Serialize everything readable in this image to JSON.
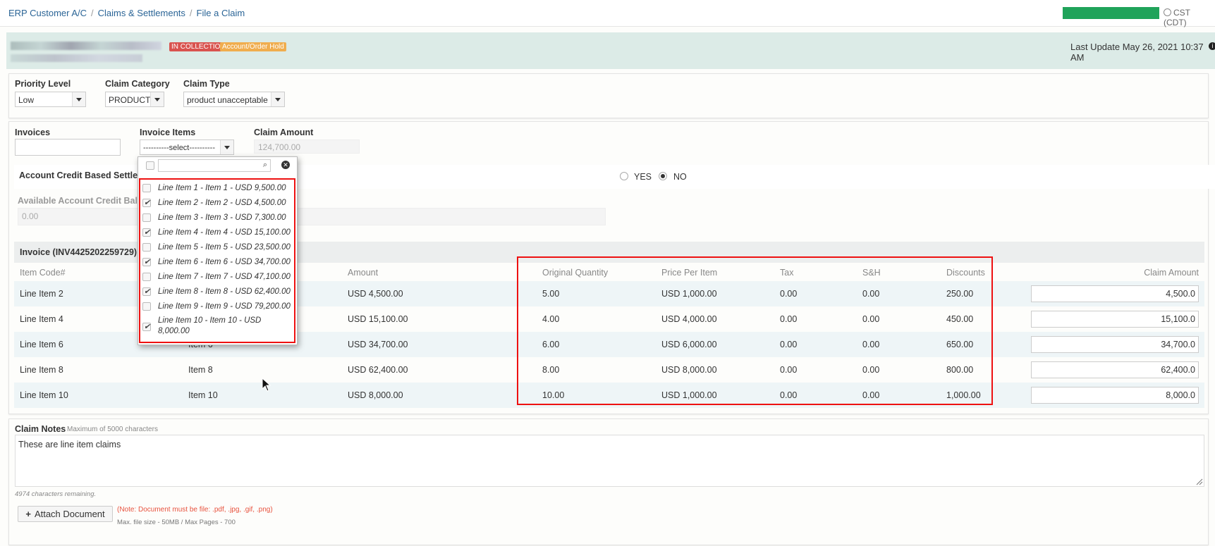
{
  "breadcrumb": [
    "ERP Customer A/C",
    "Claims & Settlements",
    "File a Claim"
  ],
  "timezone": "CST (CDT)",
  "header": {
    "badge_collection": "IN COLLECTION",
    "badge_hold": "Account/Order Hold",
    "last_update": "Last Update May 26, 2021 10:37 AM"
  },
  "claim_setup": {
    "priority_label": "Priority Level",
    "priority_value": "Low",
    "category_label": "Claim Category",
    "category_value": "PRODUCT",
    "type_label": "Claim Type",
    "type_value": "product unacceptable"
  },
  "invoice_section": {
    "invoices_label": "Invoices",
    "items_label": "Invoice Items",
    "items_value": "----------select----------",
    "claim_amount_label": "Claim Amount",
    "claim_amount_value": "124,700.00"
  },
  "credit": {
    "settlement_label": "Account Credit Based Settleme",
    "yes": "YES",
    "no": "NO",
    "selected": "NO",
    "available_label": "Available Account Credit Balan",
    "available_value": "0.00"
  },
  "dropdown": {
    "items": [
      {
        "label": "Line Item 1 - Item 1 - USD 9,500.00",
        "checked": false
      },
      {
        "label": "Line Item 2 - Item 2 - USD 4,500.00",
        "checked": true
      },
      {
        "label": "Line Item 3 - Item 3 - USD 7,300.00",
        "checked": false
      },
      {
        "label": "Line Item 4 - Item 4 - USD 15,100.00",
        "checked": true
      },
      {
        "label": "Line Item 5 - Item 5 - USD 23,500.00",
        "checked": false
      },
      {
        "label": "Line Item 6 - Item 6 - USD 34,700.00",
        "checked": true
      },
      {
        "label": "Line Item 7 - Item 7 - USD 47,100.00",
        "checked": false
      },
      {
        "label": "Line Item 8 - Item 8 - USD 62,400.00",
        "checked": true
      },
      {
        "label": "Line Item 9 - Item 9 - USD 79,200.00",
        "checked": false
      },
      {
        "label": "Line Item 10 - Item 10 - USD 8,000.00",
        "checked": true
      }
    ]
  },
  "table": {
    "title": "Invoice (INV4425202259729) It",
    "headers": [
      "Item Code#",
      "Amount",
      "Original Quantity",
      "Price Per Item",
      "Tax",
      "S&H",
      "Discounts",
      "Claim Amount"
    ],
    "rows": [
      {
        "code": "Line Item 2",
        "item": "",
        "amount": "USD 4,500.00",
        "qty": "5.00",
        "ppi": "USD 1,000.00",
        "tax": "0.00",
        "sh": "0.00",
        "disc": "250.00",
        "claim": "4,500.0"
      },
      {
        "code": "Line Item 4",
        "item": "",
        "amount": "USD 15,100.00",
        "qty": "4.00",
        "ppi": "USD 4,000.00",
        "tax": "0.00",
        "sh": "0.00",
        "disc": "450.00",
        "claim": "15,100.0"
      },
      {
        "code": "Line Item 6",
        "item": "Item 6",
        "amount": "USD 34,700.00",
        "qty": "6.00",
        "ppi": "USD 6,000.00",
        "tax": "0.00",
        "sh": "0.00",
        "disc": "650.00",
        "claim": "34,700.0"
      },
      {
        "code": "Line Item 8",
        "item": "Item 8",
        "amount": "USD 62,400.00",
        "qty": "8.00",
        "ppi": "USD 8,000.00",
        "tax": "0.00",
        "sh": "0.00",
        "disc": "800.00",
        "claim": "62,400.0"
      },
      {
        "code": "Line Item 10",
        "item": "Item 10",
        "amount": "USD 8,000.00",
        "qty": "10.00",
        "ppi": "USD 1,000.00",
        "tax": "0.00",
        "sh": "0.00",
        "disc": "1,000.00",
        "claim": "8,000.0"
      }
    ]
  },
  "notes": {
    "label": "Claim Notes",
    "hint": "Maximum of 5000 characters",
    "value": "These are line item claims",
    "remaining": "4974 characters remaining."
  },
  "attach": {
    "button": "Attach Document",
    "note": "(Note: Document must be file: .pdf, .jpg, .gif, .png)",
    "limits": "Max. file size - 50MB / Max Pages - 700"
  },
  "colors": {
    "link": "#2a6496",
    "highlight": "#e11111",
    "band": "#dcebe7",
    "badge_red": "#d9534f",
    "badge_orange": "#f0ad4e"
  }
}
